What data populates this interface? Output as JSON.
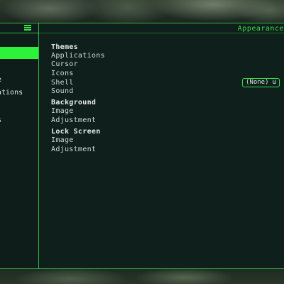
{
  "window": {
    "title": "Appearance"
  },
  "sidebar": {
    "items": [
      {
        "label": "e"
      },
      {
        "label": "ations"
      },
      {
        "label": "s"
      }
    ]
  },
  "main": {
    "sections": [
      {
        "heading": "Themes",
        "items": [
          "Applications",
          "Cursor",
          "Icons",
          "Shell",
          "Sound"
        ]
      },
      {
        "heading": "Background",
        "items": [
          "Image",
          "Adjustment"
        ]
      },
      {
        "heading": "Lock Screen",
        "items": [
          "Image",
          "Adjustment"
        ]
      }
    ],
    "shell_value": "(None) ⊍"
  },
  "colors": {
    "accent": "#2cf23a",
    "border": "#2fbf3f",
    "background": "#0f1f1c"
  }
}
